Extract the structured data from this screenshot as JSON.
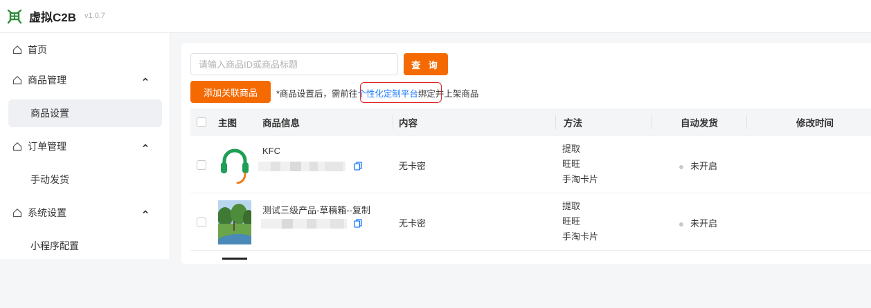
{
  "header": {
    "app_name": "虚拟C2B",
    "version": "v1.0.7"
  },
  "sidebar": {
    "items": [
      {
        "label": "首页"
      },
      {
        "label": "商品管理",
        "sub": [
          {
            "label": "商品设置"
          }
        ]
      },
      {
        "label": "订单管理",
        "sub": [
          {
            "label": "手动发货"
          }
        ]
      },
      {
        "label": "系统设置",
        "sub": [
          {
            "label": "小程序配置"
          }
        ]
      }
    ]
  },
  "toolbar": {
    "search_placeholder": "请输入商品ID或商品标题",
    "query_label": "查 询",
    "add_label": "添加关联商品",
    "notice_before": "*商品设置后，需前往",
    "notice_link": "个性化定制平台",
    "notice_after": "绑定并上架商品"
  },
  "table": {
    "headers": {
      "image": "主图",
      "info": "商品信息",
      "content": "内容",
      "method": "方法",
      "auto_ship": "自动发货",
      "modified": "修改时间"
    },
    "rows": [
      {
        "title": "KFC",
        "content": "无卡密",
        "methods": [
          "提取",
          "旺旺",
          "手淘卡片"
        ],
        "auto_ship": "未开启",
        "modified": ""
      },
      {
        "title": "测试三级产品-草稿箱--复制",
        "content": "无卡密",
        "methods": [
          "提取",
          "旺旺",
          "手淘卡片"
        ],
        "auto_ship": "未开启",
        "modified": ""
      }
    ]
  },
  "colors": {
    "accent": "#f56a00",
    "link": "#1677ff",
    "highlight_border": "#e02020",
    "logo_green": "#2e8b3a"
  },
  "icons": [
    "logo-icon",
    "home-icon",
    "chevron-up-icon",
    "copy-icon"
  ]
}
